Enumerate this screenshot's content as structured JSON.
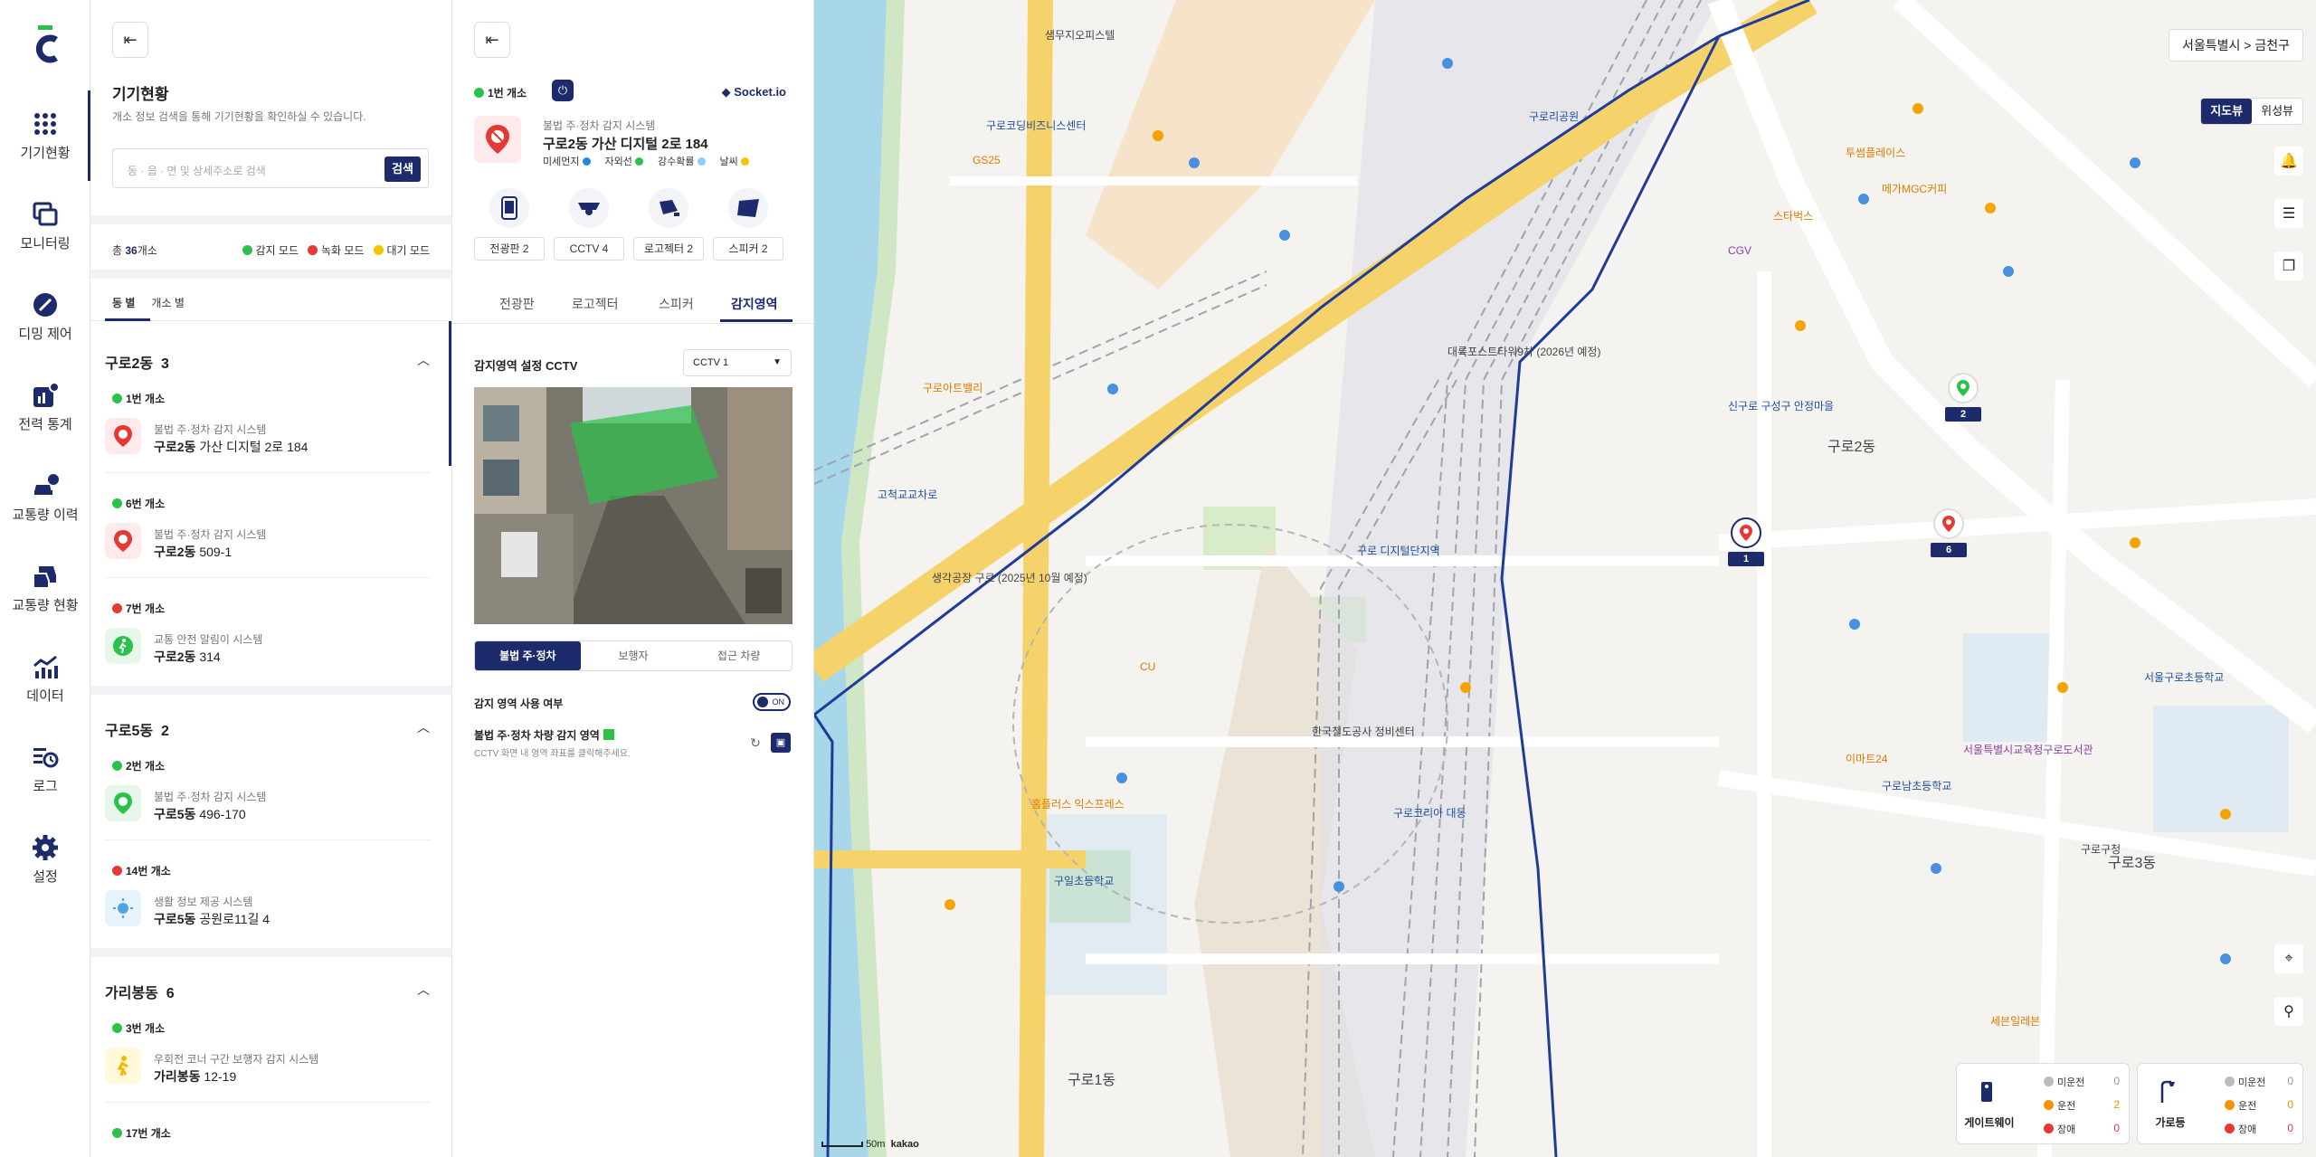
{
  "rail": {
    "items": [
      {
        "label": "기기현황"
      },
      {
        "label": "모니터링"
      },
      {
        "label": "디밍 제어"
      },
      {
        "label": "전력 통계"
      },
      {
        "label": "교통량 이력"
      },
      {
        "label": "교통량 현황"
      },
      {
        "label": "데이터"
      },
      {
        "label": "로그"
      },
      {
        "label": "설정"
      }
    ]
  },
  "panel1": {
    "title": "기기현황",
    "desc": "개소 정보 검색을 통해 기기현황을 확인하실 수 있습니다.",
    "search": {
      "placeholder": "동 · 읍 · 면 및 상세주소로 검색",
      "button": "검색"
    },
    "total_prefix": "총 ",
    "total_count": "36",
    "total_suffix": "개소",
    "legend": [
      {
        "label": "감지 모드",
        "color": "#2bc24a"
      },
      {
        "label": "녹화 모드",
        "color": "#e53935"
      },
      {
        "label": "대기 모드",
        "color": "#f5c400"
      }
    ],
    "subtabs": [
      "동 별",
      "개소 별"
    ],
    "groups": [
      {
        "name": "구로2동",
        "count": "3",
        "devices": [
          {
            "status": "1번 개소",
            "color": "#2bc24a",
            "system": "불법 주·정차 감지 시스템",
            "dong": "구로2동",
            "addr": "가산 디지털 2로 184"
          },
          {
            "status": "6번 개소",
            "color": "#2bc24a",
            "system": "불법 주·정차 감지 시스템",
            "dong": "구로2동",
            "addr": "509-1"
          },
          {
            "status": "7번 개소",
            "color": "#e53935",
            "system": "교통 안전 알림이 시스템",
            "dong": "구로2동",
            "addr": "314"
          }
        ]
      },
      {
        "name": "구로5동",
        "count": "2",
        "devices": [
          {
            "status": "2번 개소",
            "color": "#2bc24a",
            "system": "불법 주·정차 감지 시스템",
            "dong": "구로5동",
            "addr": "496-170"
          },
          {
            "status": "14번 개소",
            "color": "#e53935",
            "system": "생활 정보 제공 시스템",
            "dong": "구로5동",
            "addr": "공원로11길 4"
          }
        ]
      },
      {
        "name": "가리봉동",
        "count": "6",
        "devices": [
          {
            "status": "3번 개소",
            "color": "#2bc24a",
            "system": "우회전 코너 구간 보행자 감지 시스템",
            "dong": "가리봉동",
            "addr": "12-19"
          },
          {
            "status": "17번 개소",
            "color": "#2bc24a"
          }
        ]
      }
    ]
  },
  "panel2": {
    "status": "1번 개소",
    "socket": "Socket.io",
    "system": "불법 주·정차 감지 시스템",
    "address": "구로2동 가산 디지털 2로 184",
    "env": [
      {
        "label": "미세먼지",
        "color": "#1e88e5"
      },
      {
        "label": "자외선",
        "color": "#2bc24a"
      },
      {
        "label": "강수확률",
        "color": "#90caf9"
      },
      {
        "label": "날씨",
        "color": "#f5c400"
      }
    ],
    "devices": [
      "전광판 2",
      "CCTV 4",
      "로고젝터 2",
      "스피커 2"
    ],
    "tabs": [
      "전광판",
      "로고젝터",
      "스피커",
      "감지영역"
    ],
    "area_title": "감지영역 설정 CCTV",
    "cctv_select": "CCTV 1",
    "modes": [
      "불법 주·정차",
      "보행자",
      "접근 차량"
    ],
    "use_label": "감지 영역 사용 여부",
    "toggle": "ON",
    "zone_label": "불법 주·정차 차량 감지 영역",
    "zone_desc": "CCTV 화면 내 영역 좌표를 클릭해주세요."
  },
  "map": {
    "location": "서울특별시 > 금천구",
    "types": [
      "지도뷰",
      "위성뷰"
    ],
    "markers": [
      {
        "num": "2",
        "color": "#2bc24a"
      },
      {
        "num": "1",
        "color": "#e53935"
      },
      {
        "num": "6",
        "color": "#e53935"
      }
    ],
    "stats": [
      {
        "name": "게이트웨이",
        "rows": [
          {
            "label": "미운전",
            "value": "0",
            "color": "#bbb"
          },
          {
            "label": "운전",
            "value": "2",
            "color": "#f59300"
          },
          {
            "label": "장애",
            "value": "0",
            "color": "#e53935"
          }
        ]
      },
      {
        "name": "가로등",
        "rows": [
          {
            "label": "미운전",
            "value": "0",
            "color": "#bbb"
          },
          {
            "label": "운전",
            "value": "0",
            "color": "#f59300"
          },
          {
            "label": "장애",
            "value": "0",
            "color": "#e53935"
          }
        ]
      }
    ],
    "scale": "50m",
    "brand": "kakao",
    "labels": [
      {
        "t": "샘무지오피스텔"
      },
      {
        "t": "구로코딩비즈니스센터",
        "c": "b"
      },
      {
        "t": "구로 디지털단지역",
        "c": "b"
      },
      {
        "t": "구로2동"
      },
      {
        "t": "구로1동"
      },
      {
        "t": "구로3동"
      },
      {
        "t": "신구로 구성구 안정마을",
        "c": "b"
      },
      {
        "t": "서울구로초등학교",
        "c": "b"
      },
      {
        "t": "구로남초등학교",
        "c": "b"
      },
      {
        "t": "한국철도공사 정비센터"
      },
      {
        "t": "서울특별시교육청구로도서관"
      },
      {
        "t": "구로구청"
      },
      {
        "t": "대륙포스트타워9차 (2026년 예정)"
      },
      {
        "t": "생각공장 구로 (2025년 10월 예정)"
      },
      {
        "t": "구일초등학교",
        "c": "b"
      },
      {
        "t": "구로코리아 대동",
        "c": "b"
      },
      {
        "t": "구로아트밸리",
        "c": "o"
      },
      {
        "t": "고척교교차로",
        "c": "b"
      },
      {
        "t": "CGV",
        "c": "p"
      },
      {
        "t": "구로리공원",
        "c": "b"
      },
      {
        "t": "스타벅스",
        "c": "o"
      },
      {
        "t": "홈플러스 익스프레스",
        "c": "o"
      },
      {
        "t": "이마트24",
        "c": "o"
      },
      {
        "t": "GS25",
        "c": "o"
      },
      {
        "t": "CU",
        "c": "o"
      },
      {
        "t": "세븐일레븐",
        "c": "o"
      },
      {
        "t": "투썸플레이스",
        "c": "o"
      },
      {
        "t": "메가MGC커피",
        "c": "o"
      }
    ]
  }
}
